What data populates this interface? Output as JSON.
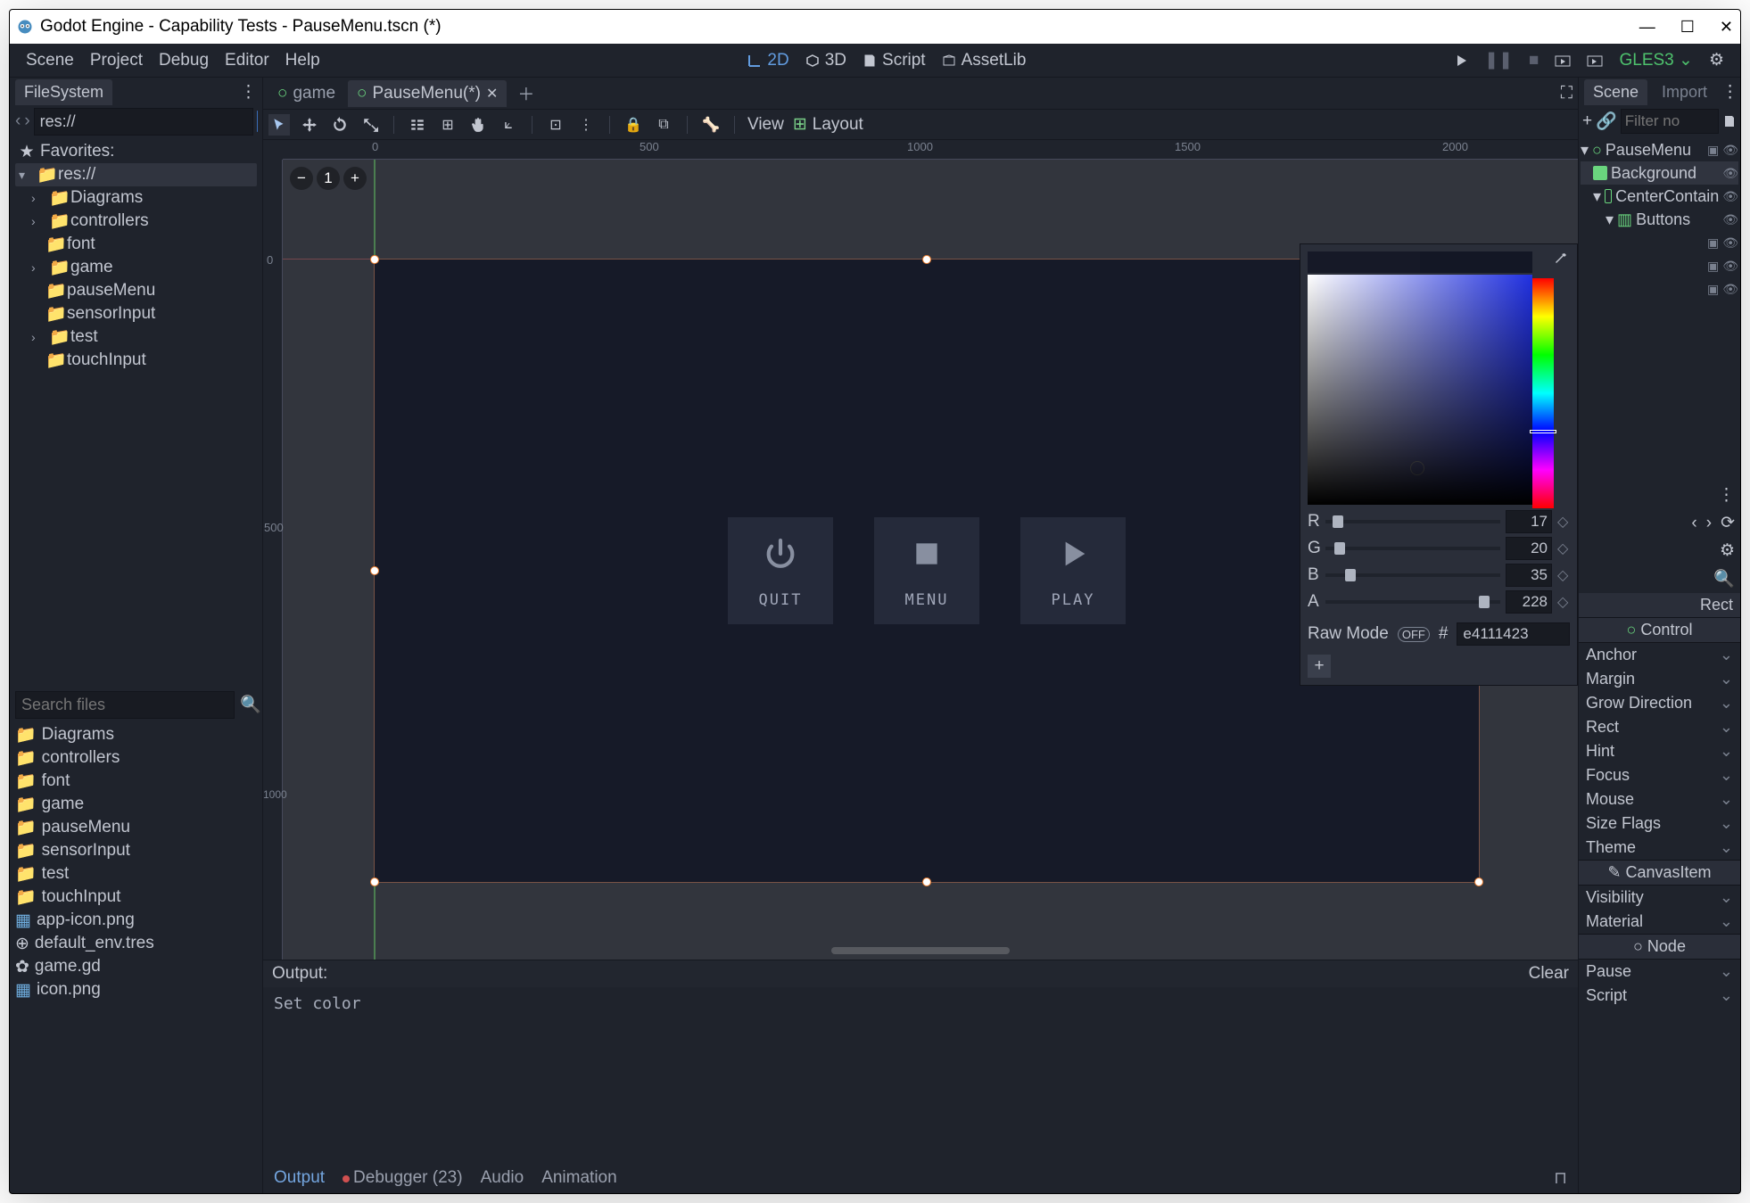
{
  "window": {
    "title": "Godot Engine - Capability Tests - PauseMenu.tscn (*)"
  },
  "menubar": {
    "scene": "Scene",
    "project": "Project",
    "debug": "Debug",
    "editor": "Editor",
    "help": "Help",
    "ws2d": "2D",
    "ws3d": "3D",
    "wsScript": "Script",
    "wsAssetLib": "AssetLib",
    "renderer": "GLES3"
  },
  "filesystem": {
    "tab": "FileSystem",
    "path": "res://",
    "favorites": "Favorites:",
    "root": "res://",
    "folders": [
      "Diagrams",
      "controllers",
      "font",
      "game",
      "pauseMenu",
      "sensorInput",
      "test",
      "touchInput"
    ],
    "searchPlaceholder": "Search files",
    "files": [
      "Diagrams",
      "controllers",
      "font",
      "game",
      "pauseMenu",
      "sensorInput",
      "test",
      "touchInput",
      "app-icon.png",
      "default_env.tres",
      "game.gd",
      "icon.png"
    ]
  },
  "openScenes": {
    "tab1": "game",
    "tab2": "PauseMenu(*)"
  },
  "viewportToolbar": {
    "view": "View",
    "layout": "Layout"
  },
  "rulerTicks": {
    "h": [
      "0",
      "500",
      "1000",
      "1500",
      "2000"
    ],
    "v": [
      "0",
      "500",
      "1000"
    ]
  },
  "gameButtons": {
    "quit": "QUIT",
    "menu": "MENU",
    "play": "PLAY"
  },
  "colorPicker": {
    "r": {
      "label": "R",
      "value": "17"
    },
    "g": {
      "label": "G",
      "value": "20"
    },
    "b": {
      "label": "B",
      "value": "35"
    },
    "a": {
      "label": "A",
      "value": "228"
    },
    "rawMode": "Raw Mode",
    "rawToggle": "OFF",
    "hashLabel": "#",
    "hex": "e4111423"
  },
  "output": {
    "title": "Output:",
    "clear": "Clear",
    "body": "Set color",
    "tabs": {
      "output": "Output",
      "debugger": "Debugger (23)",
      "audio": "Audio",
      "animation": "Animation"
    }
  },
  "sceneDock": {
    "sceneTab": "Scene",
    "importTab": "Import",
    "filterPlaceholder": "Filter no",
    "nodes": {
      "root": "PauseMenu",
      "bg": "Background",
      "cc": "CenterContain",
      "buttons": "Buttons"
    }
  },
  "inspector": {
    "rectLabel": "Rect",
    "controlHeader": "Control",
    "props": [
      "Anchor",
      "Margin",
      "Grow Direction",
      "Rect",
      "Hint",
      "Focus",
      "Mouse",
      "Size Flags",
      "Theme"
    ],
    "canvasHeader": "CanvasItem",
    "canvasProps": [
      "Visibility",
      "Material"
    ],
    "nodeHeader": "Node",
    "nodeProps": [
      "Pause",
      "Script"
    ]
  }
}
